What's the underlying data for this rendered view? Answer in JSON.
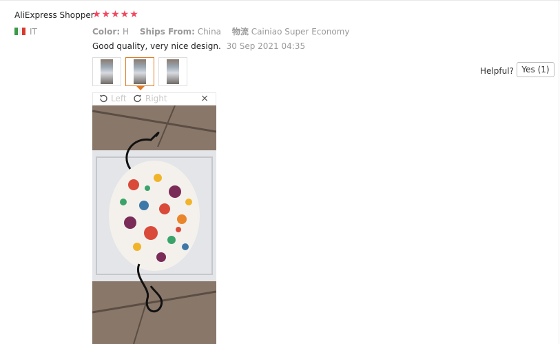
{
  "review": {
    "user_name": "AliExpress Shopper",
    "rating_stars": "★★★★★",
    "country_code": "IT",
    "flag_colors": [
      "#3a9a48",
      "#ffffff",
      "#d8392f"
    ],
    "color_label": "Color:",
    "color_value": "H",
    "ships_label": "Ships From:",
    "ships_value": "China",
    "logistics_label": "物流",
    "logistics_value": "Cainiao Super Economy",
    "text": "Good quality, very nice design.",
    "date": "30 Sep 2021 04:35",
    "thumbnails_count": 3,
    "selected_thumbnail": 2
  },
  "helpful": {
    "label": "Helpful?",
    "yes_label": "Yes (1)"
  },
  "viewer": {
    "rotate_left_label": "Left",
    "rotate_right_label": "Right",
    "close_label": "×"
  },
  "colors": {
    "star": "#f2475f",
    "accent_border": "#e07a22"
  }
}
